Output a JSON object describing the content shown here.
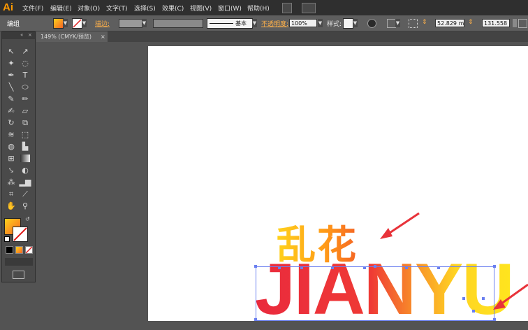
{
  "app": {
    "logo": "Ai"
  },
  "menu": [
    "文件(F)",
    "编辑(E)",
    "对象(O)",
    "文字(T)",
    "选择(S)",
    "效果(C)",
    "视图(V)",
    "窗口(W)",
    "帮助(H)"
  ],
  "control_bar": {
    "mode_label": "编组",
    "stroke_label": "描边:",
    "stroke_profile": "基本",
    "opacity_label": "不透明度:",
    "opacity_value": "100%",
    "style_label": "样式:",
    "x_value": "52.829 m",
    "y_value": "131.558"
  },
  "document": {
    "tab_title": "149% (CMYK/预览)",
    "close_glyph": "×"
  },
  "canvas": {
    "text_top": "乱花",
    "text_main": "JIANYU"
  },
  "colors": {
    "accent": "#ff9a00",
    "fill_gradient": [
      "#ffd21c",
      "#f56524"
    ],
    "text_gradient": [
      "#ea2a3d",
      "#ffe51e"
    ],
    "arrow": "#e8333a",
    "selection": "#6a7ff0"
  },
  "icons": [
    "selection-tool-icon",
    "direct-selection-icon",
    "magic-wand-icon",
    "lasso-icon",
    "pen-icon",
    "type-icon",
    "line-icon",
    "ellipse-icon",
    "paintbrush-icon",
    "pencil-icon",
    "blob-brush-icon",
    "eraser-icon",
    "rotate-icon",
    "scale-icon",
    "warp-icon",
    "free-transform-icon",
    "shape-builder-icon",
    "perspective-icon",
    "mesh-icon",
    "gradient-icon",
    "eyedropper-icon",
    "blend-icon",
    "symbol-sprayer-icon",
    "graph-icon",
    "artboard-icon",
    "slice-icon",
    "hand-icon",
    "zoom-icon"
  ]
}
